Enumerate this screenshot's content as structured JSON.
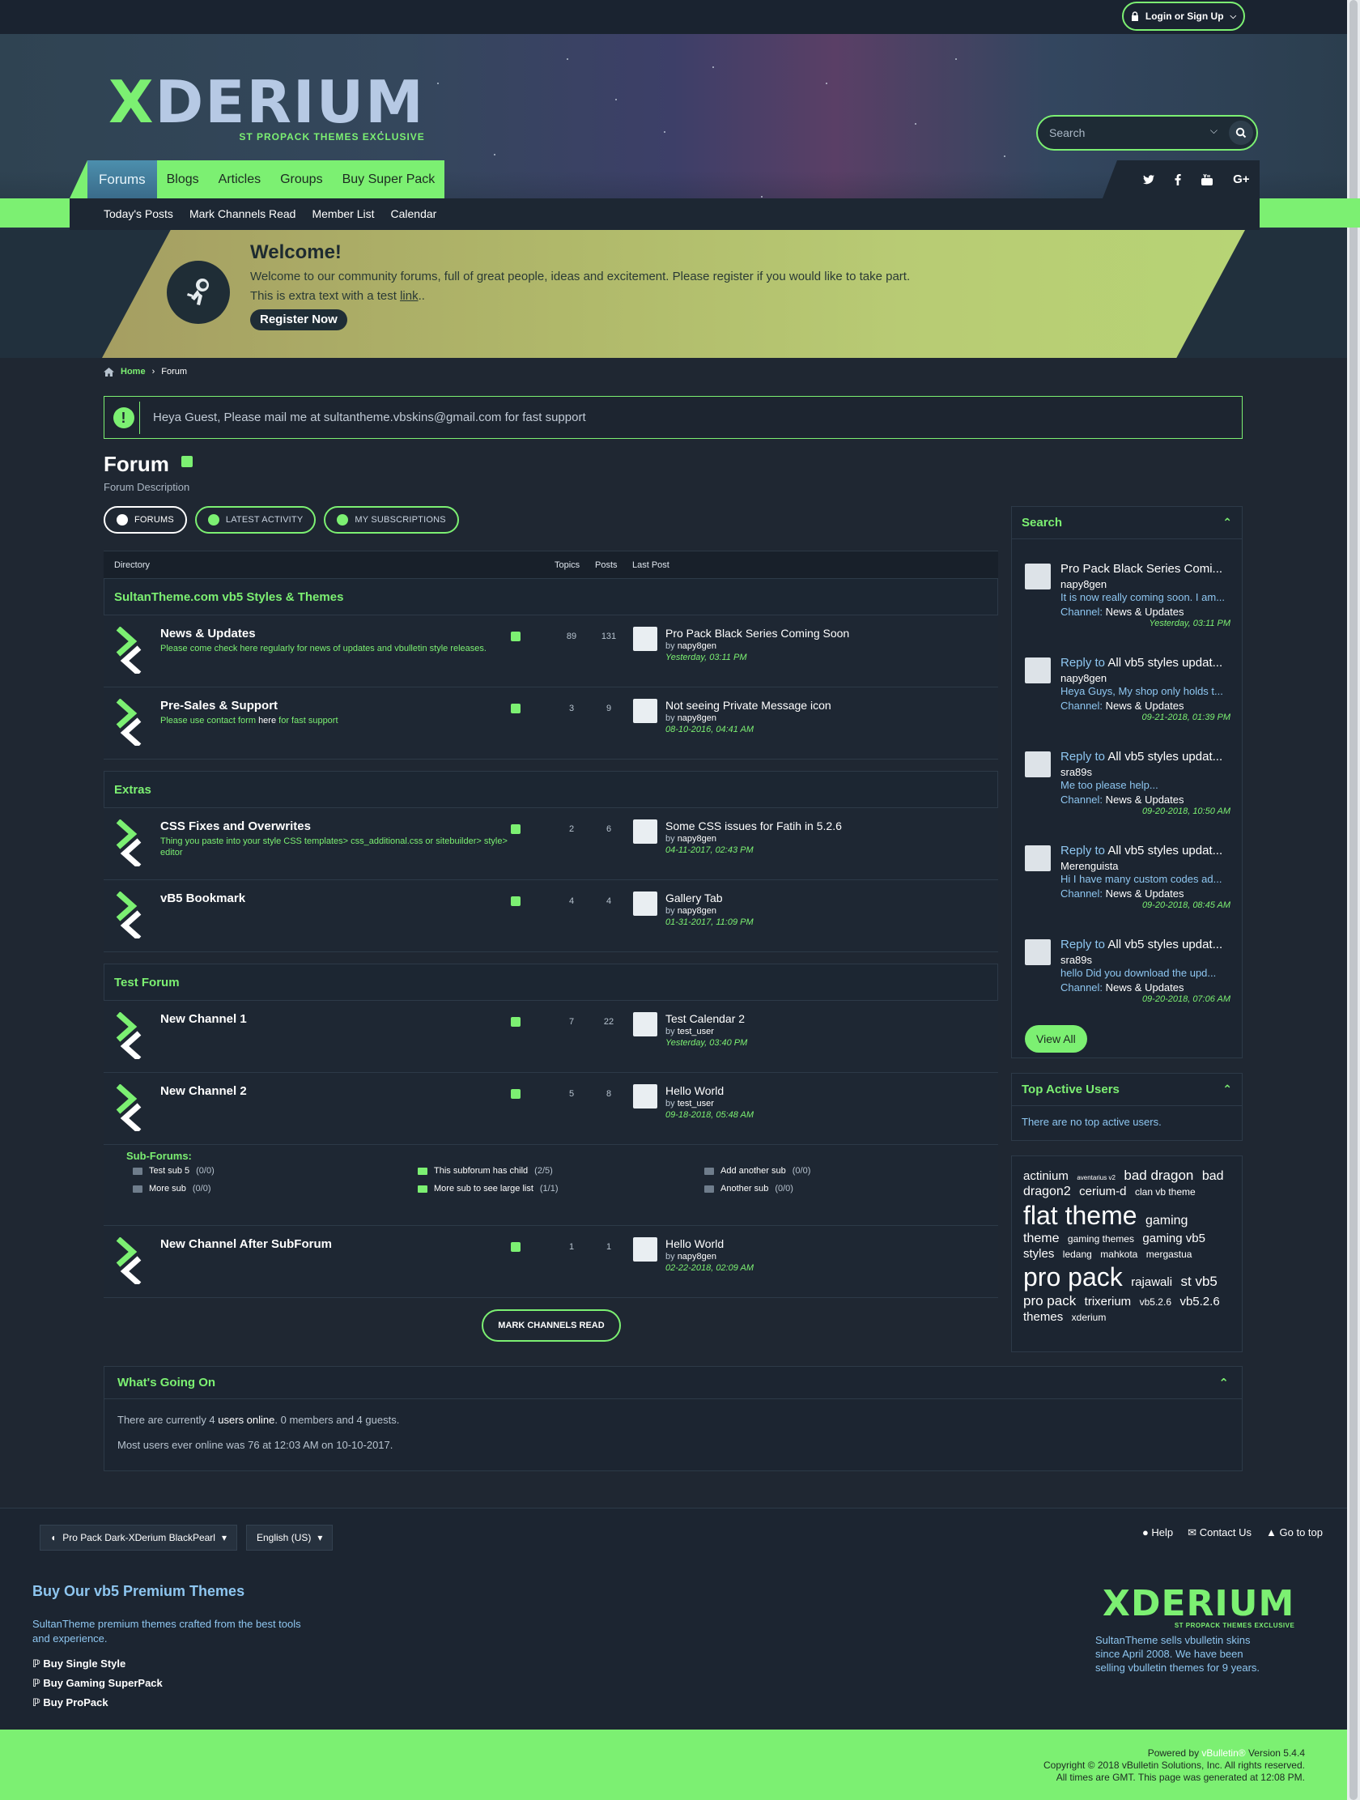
{
  "topbar": {
    "login_label": "Login or Sign Up"
  },
  "brand": {
    "logo_x": "X",
    "logo_rest": "DERIUM",
    "tagline": "ST PROPACK THEMES EXCLUSIVE"
  },
  "search": {
    "placeholder": "Search"
  },
  "nav": {
    "tabs": [
      "Forums",
      "Blogs",
      "Articles",
      "Groups",
      "Buy Super Pack"
    ],
    "subnav": [
      "Today's Posts",
      "Mark Channels Read",
      "Member List",
      "Calendar"
    ],
    "social": [
      "twitter-icon",
      "facebook-icon",
      "youtube-icon",
      "google-plus-icon"
    ]
  },
  "welcome": {
    "title": "Welcome!",
    "line1": "Welcome to our community forums, full of great people, ideas and excitement. Please register if you would like to take part.",
    "line2_prefix": "This is extra text with a test ",
    "line2_link": "link",
    "line2_suffix": "..",
    "register": "Register Now"
  },
  "breadcrumb": {
    "home": "Home",
    "current": "Forum"
  },
  "notice": "Heya Guest, Please mail me at sultantheme.vbskins@gmail.com for fast support",
  "page": {
    "title": "Forum",
    "description": "Forum Description"
  },
  "pills": [
    "FORUMS",
    "LATEST ACTIVITY",
    "MY SUBSCRIPTIONS"
  ],
  "table": {
    "headers": {
      "directory": "Directory",
      "topics": "Topics",
      "posts": "Posts",
      "last_post": "Last Post"
    },
    "sections": [
      {
        "name": "SultanTheme.com vb5 Styles & Themes",
        "channels": [
          {
            "name": "News & Updates",
            "desc": "Please come check here regularly for news of updates and vbulletin style releases.",
            "topics": "89",
            "posts": "131",
            "lp_title": "Pro Pack Black Series Coming Soon",
            "lp_by": "by",
            "lp_user": "napy8gen",
            "lp_date": "Yesterday, 03:11 PM"
          },
          {
            "name": "Pre-Sales & Support",
            "desc_prefix": "Please use contact form ",
            "desc_link": "here",
            "desc_suffix": " for fast support",
            "topics": "3",
            "posts": "9",
            "lp_title": "Not seeing Private Message icon",
            "lp_by": "by",
            "lp_user": "napy8gen",
            "lp_date": "08-10-2016, 04:41 AM"
          }
        ]
      },
      {
        "name": "Extras",
        "channels": [
          {
            "name": "CSS Fixes and Overwrites",
            "desc": "Thing you paste into your style CSS templates> css_additional.css or sitebuilder> style> editor",
            "topics": "2",
            "posts": "6",
            "lp_title": "Some CSS issues for Fatih in 5.2.6",
            "lp_by": "by",
            "lp_user": "napy8gen",
            "lp_date": "04-11-2017, 02:43 PM"
          },
          {
            "name": "vB5 Bookmark",
            "desc": "",
            "topics": "4",
            "posts": "4",
            "lp_title": "Gallery Tab",
            "lp_by": "by",
            "lp_user": "napy8gen",
            "lp_date": "01-31-2017, 11:09 PM"
          }
        ]
      },
      {
        "name": "Test Forum",
        "channels": [
          {
            "name": "New Channel 1",
            "desc": "",
            "topics": "7",
            "posts": "22",
            "lp_title": "Test Calendar 2",
            "lp_by": "by",
            "lp_user": "test_user",
            "lp_date": "Yesterday, 03:40 PM"
          },
          {
            "name": "New Channel 2",
            "desc": "",
            "topics": "5",
            "posts": "8",
            "lp_title": "Hello World",
            "lp_by": "by",
            "lp_user": "test_user",
            "lp_date": "09-18-2018, 05:48 AM"
          },
          {
            "name": "New Channel After SubForum",
            "desc": "",
            "topics": "1",
            "posts": "1",
            "lp_title": "Hello World",
            "lp_by": "by",
            "lp_user": "napy8gen",
            "lp_date": "02-22-2018, 02:09 AM"
          }
        ]
      }
    ],
    "subforums": {
      "label": "Sub-Forums:",
      "items": [
        {
          "name": "Test sub 5",
          "count": "(0/0)"
        },
        {
          "name": "More sub",
          "count": "(0/0)"
        },
        {
          "name": "This subforum has child",
          "count": "(2/5)"
        },
        {
          "name": "More sub to see large list",
          "count": "(1/1)"
        },
        {
          "name": "Add another sub",
          "count": "(0/0)"
        },
        {
          "name": "Another sub",
          "count": "(0/0)"
        }
      ]
    },
    "mark_read": "MARK CHANNELS READ"
  },
  "sidebar": {
    "search_title": "Search",
    "activity": [
      {
        "reply": "",
        "title": "Pro Pack Black Series Comi...",
        "user": "napy8gen",
        "snippet": "It is now really coming soon. I am...",
        "channel_label": "Channel:",
        "channel": "News & Updates",
        "date": "Yesterday, 03:11 PM"
      },
      {
        "reply": "Reply to",
        "title": "All vb5 styles updat...",
        "user": "napy8gen",
        "snippet": "Heya Guys, My shop only holds t...",
        "channel_label": "Channel:",
        "channel": "News & Updates",
        "date": "09-21-2018, 01:39 PM"
      },
      {
        "reply": "Reply to",
        "title": "All vb5 styles updat...",
        "user": "sra89s",
        "snippet": "Me too please help...",
        "channel_label": "Channel:",
        "channel": "News & Updates",
        "date": "09-20-2018, 10:50 AM"
      },
      {
        "reply": "Reply to",
        "title": "All vb5 styles updat...",
        "user": "Merenguista",
        "snippet": "Hi I have many custom codes ad...",
        "channel_label": "Channel:",
        "channel": "News & Updates",
        "date": "09-20-2018, 08:45 AM"
      },
      {
        "reply": "Reply to",
        "title": "All vb5 styles updat...",
        "user": "sra89s",
        "snippet": "hello Did you download the upd...",
        "channel_label": "Channel:",
        "channel": "News & Updates",
        "date": "09-20-2018, 07:06 AM"
      }
    ],
    "view_all": "View All",
    "top_users_title": "Top Active Users",
    "top_users_empty": "There are no top active users.",
    "tags": [
      {
        "t": "actinium",
        "s": 15
      },
      {
        "t": "aventarius v2",
        "s": 8
      },
      {
        "t": "bad dragon",
        "s": 17
      },
      {
        "t": "bad dragon2",
        "s": 16
      },
      {
        "t": "cerium-d",
        "s": 15
      },
      {
        "t": "clan vb theme",
        "s": 12
      },
      {
        "t": "flat theme",
        "s": 32
      },
      {
        "t": "gaming theme",
        "s": 16
      },
      {
        "t": "gaming themes",
        "s": 12
      },
      {
        "t": "gaming vb5 styles",
        "s": 15
      },
      {
        "t": "ledang",
        "s": 12
      },
      {
        "t": "mahkota",
        "s": 12
      },
      {
        "t": "mergastua",
        "s": 12
      },
      {
        "t": "pro pack",
        "s": 32
      },
      {
        "t": "rajawali",
        "s": 15
      },
      {
        "t": "st vb5 pro pack",
        "s": 17
      },
      {
        "t": "trixerium",
        "s": 15
      },
      {
        "t": "vb5.2.6",
        "s": 12
      },
      {
        "t": "vb5.2.6 themes",
        "s": 15
      },
      {
        "t": "xderium",
        "s": 12
      }
    ]
  },
  "wgo": {
    "title": "What's Going On",
    "l1_a": "There are currently 4 ",
    "l1_b": "users online",
    "l1_c": ". 0 members and 4 guests.",
    "l2": "Most users ever online was 76 at 12:03 AM on 10-10-2017."
  },
  "footer": {
    "style": "Pro Pack Dark-XDerium BlackPearl",
    "language": "English (US)",
    "links": [
      "Help",
      "Contact Us",
      "Go to top"
    ],
    "buy_title": "Buy Our vb5 Premium Themes",
    "buy_text": "SultanTheme premium themes crafted from the best tools and experience.",
    "buy_items": [
      "Buy Single Style",
      "Buy Gaming SuperPack",
      "Buy ProPack"
    ],
    "sells": "SultanTheme sells vbulletin skins since April 2008. We have been selling vbulletin themes for 9 years."
  },
  "copyright": {
    "powered_prefix": "Powered by ",
    "powered_brand": "vBulletin®",
    "powered_suffix": " Version 5.4.4",
    "line2": "Copyright © 2018 vBulletin Solutions, Inc. All rights reserved.",
    "line3": "All times are GMT. This page was generated at 12:08 PM."
  },
  "colors": {
    "accent": "#7cf072",
    "bg": "#1f2732",
    "link": "#8ec6f0"
  }
}
